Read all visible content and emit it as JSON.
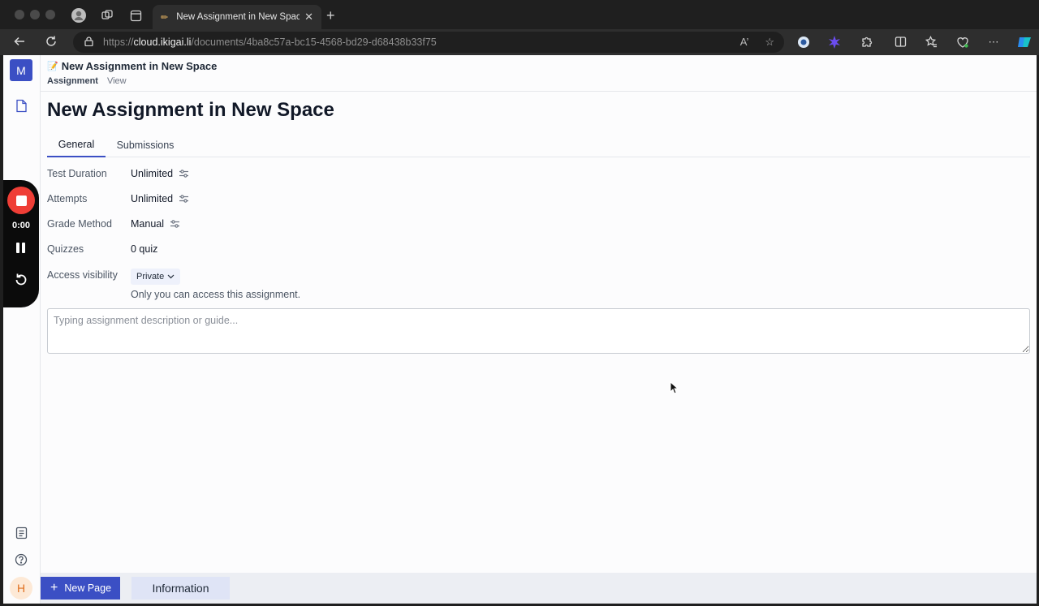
{
  "browser": {
    "tab_title": "New Assignment in New Space",
    "tab_favicon": "✏️",
    "url_scheme": "https://",
    "url_host": "cloud.ikigai.li",
    "url_path": "/documents/4ba8c57a-bc15-4568-bd29-d68438b33f75",
    "read_aloud_glyph": "A’"
  },
  "rail": {
    "workspace_initial": "M",
    "user_initial": "H"
  },
  "recorder": {
    "time": "0:00"
  },
  "header": {
    "emoji": "📝",
    "doc_title": "New Assignment in New Space",
    "crumb_assignment": "Assignment",
    "crumb_view": "View"
  },
  "main": {
    "title": "New Assignment in New Space",
    "tabs": [
      {
        "label": "General",
        "active": true
      },
      {
        "label": "Submissions",
        "active": false
      }
    ],
    "rows": [
      {
        "label": "Test Duration",
        "value": "Unlimited"
      },
      {
        "label": "Attempts",
        "value": "Unlimited"
      },
      {
        "label": "Grade Method",
        "value": "Manual"
      },
      {
        "label": "Quizzes",
        "value": "0 quiz"
      },
      {
        "label": "Access visibility",
        "value": "Private"
      }
    ],
    "access_note": "Only you can access this assignment.",
    "description_placeholder": "Typing assignment description or guide...",
    "description_value": ""
  },
  "bottom": {
    "new_page_label": "New Page",
    "information_label": "Information"
  },
  "colors": {
    "accent": "#3b4fc4",
    "record": "#ef3e36",
    "avatar_bg": "#fde9d6"
  }
}
